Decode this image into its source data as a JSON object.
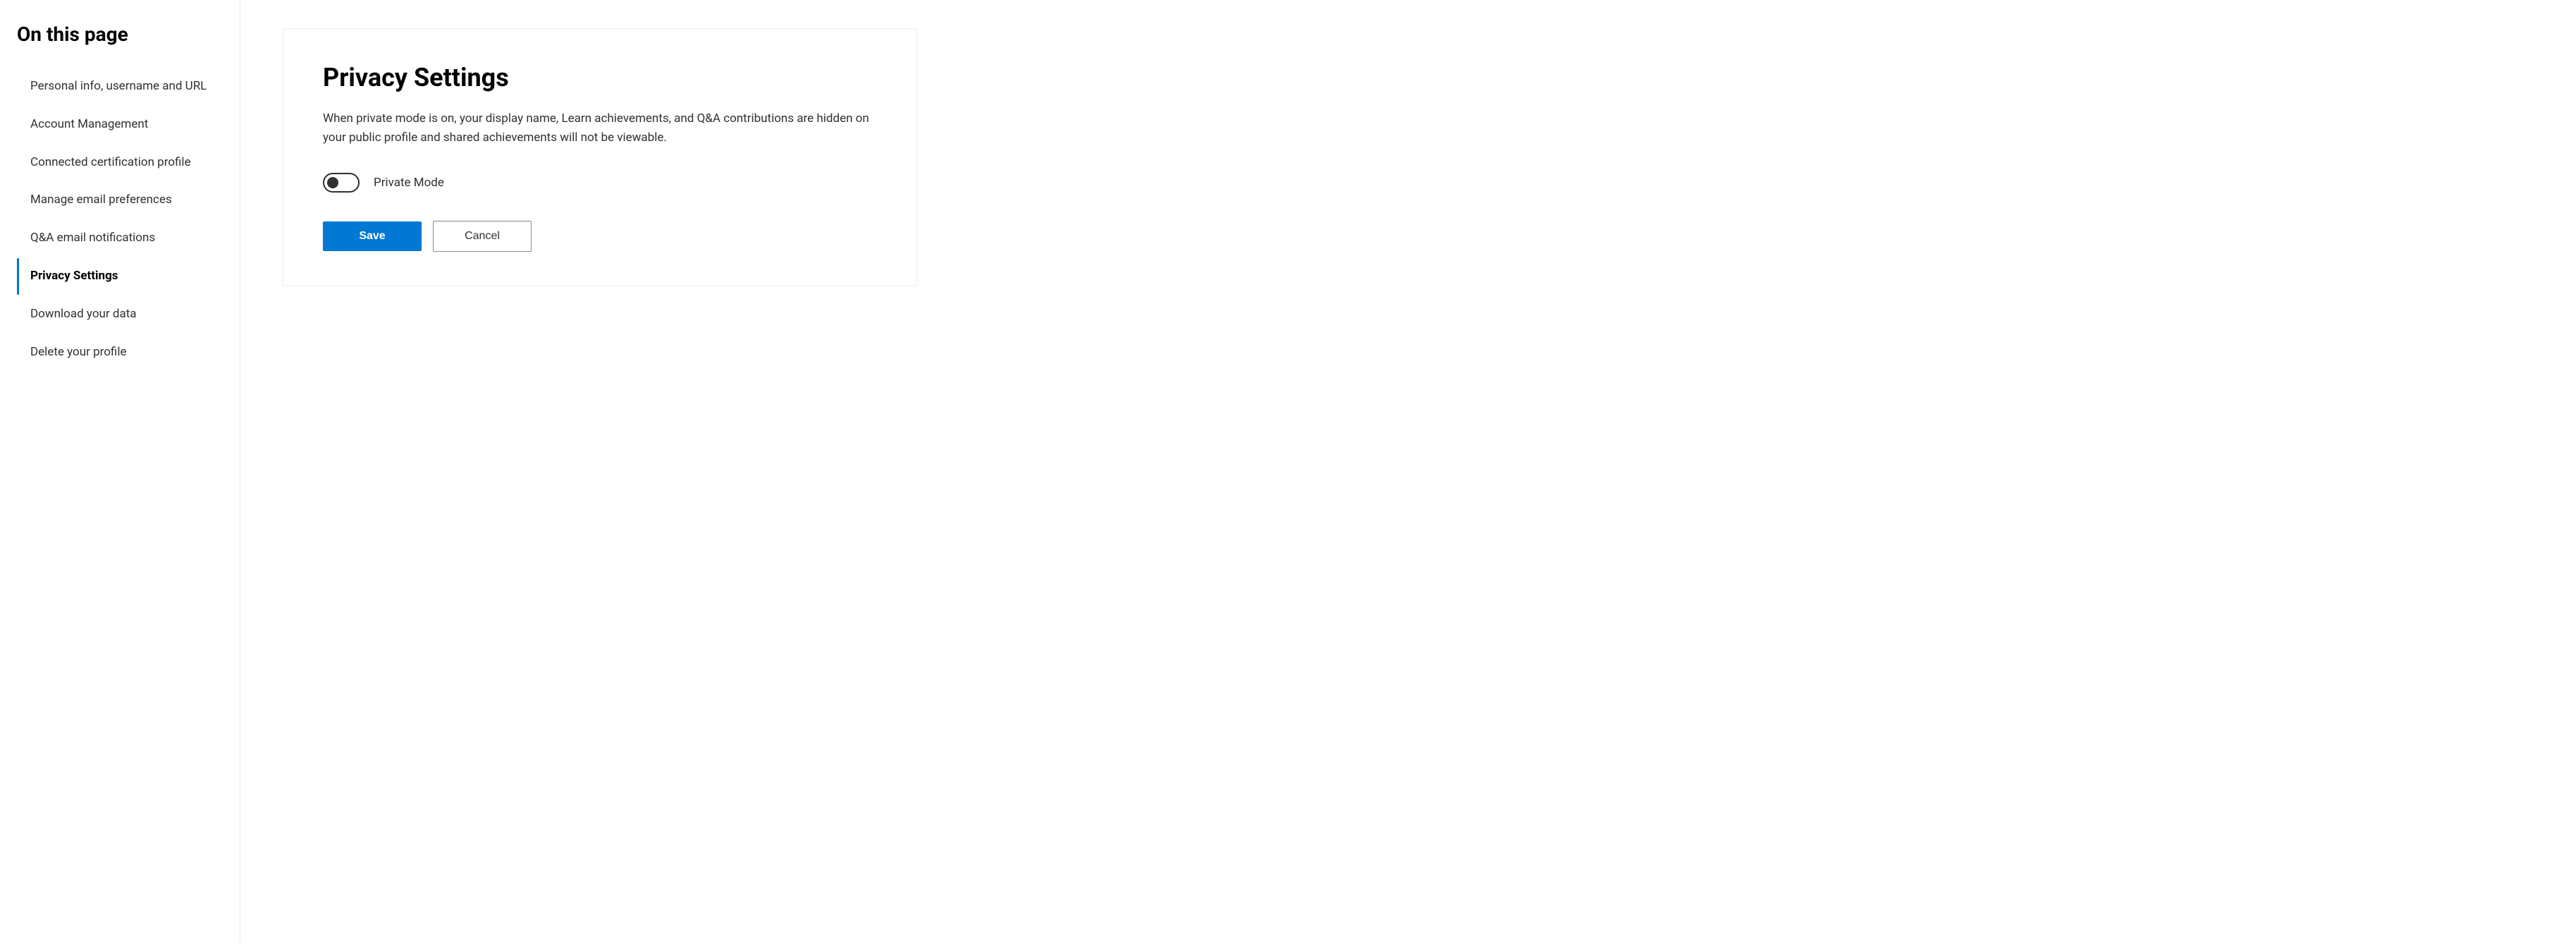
{
  "sidebar": {
    "title": "On this page",
    "items": [
      {
        "id": "personal-info",
        "label": "Personal info, username and URL",
        "active": false
      },
      {
        "id": "account-management",
        "label": "Account Management",
        "active": false
      },
      {
        "id": "connected-certification",
        "label": "Connected certification profile",
        "active": false
      },
      {
        "id": "manage-email",
        "label": "Manage email preferences",
        "active": false
      },
      {
        "id": "qa-email",
        "label": "Q&A email notifications",
        "active": false
      },
      {
        "id": "privacy-settings",
        "label": "Privacy Settings",
        "active": true
      },
      {
        "id": "download-data",
        "label": "Download your data",
        "active": false
      },
      {
        "id": "delete-profile",
        "label": "Delete your profile",
        "active": false
      }
    ]
  },
  "main": {
    "section": {
      "title": "Privacy Settings",
      "description": "When private mode is on, your display name, Learn achievements, and Q&A contributions are hidden on your public profile and shared achievements will not be viewable.",
      "toggle_label": "Private Mode",
      "toggle_state": false,
      "save_label": "Save",
      "cancel_label": "Cancel"
    }
  }
}
